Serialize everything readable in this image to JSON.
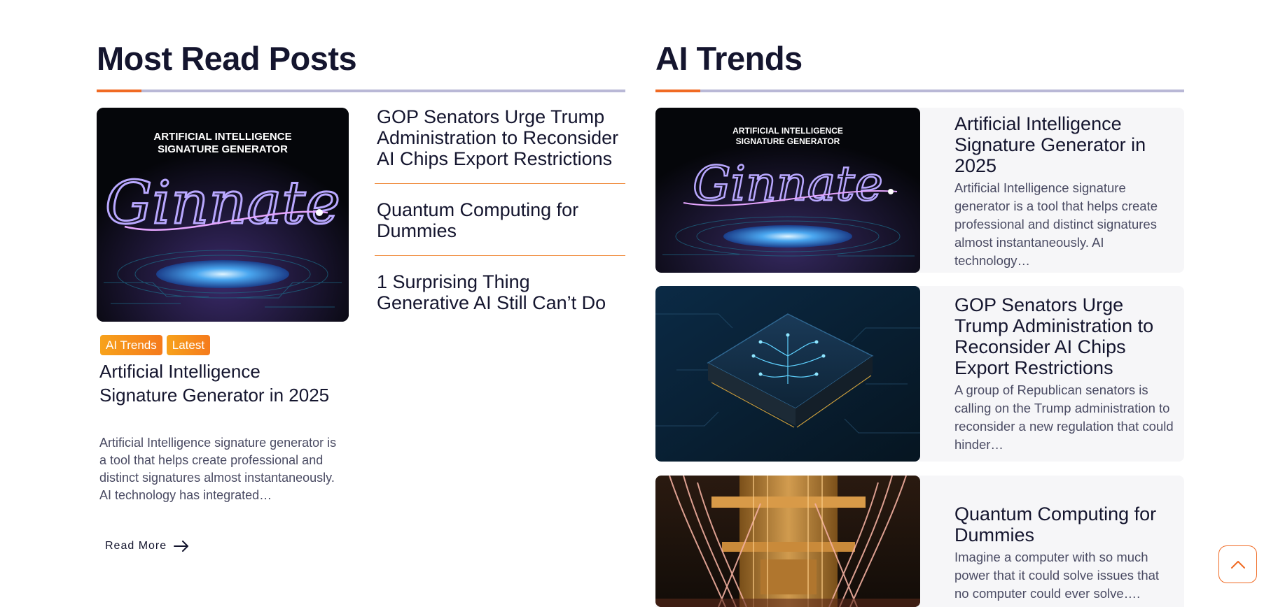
{
  "most_read": {
    "heading": "Most Read Posts",
    "featured": {
      "image_text_line1": "ARTIFICIAL INTELLIGENCE",
      "image_text_line2": "SIGNATURE GENERATOR",
      "image_script": "Ginnate",
      "tags": [
        "AI Trends",
        "Latest"
      ],
      "title": "Artificial Intelligence Signature Generator in 2025",
      "excerpt": "Artificial Intelligence signature generator is a tool that helps create professional and distinct signatures almost instantaneously. AI technology has integrated…",
      "read_more": "Read More"
    },
    "list": [
      "GOP Senators Urge Trump Administration to Reconsider AI Chips Export Restrictions",
      "Quantum Computing for Dummies",
      "1 Surprising Thing Generative AI Still Can’t Do"
    ]
  },
  "ai_trends": {
    "heading": "AI Trends",
    "cards": [
      {
        "title": "Artificial Intelligence Signature Generator in 2025",
        "excerpt": "Artificial Intelligence signature generator is a tool that helps create professional and distinct signatures almost instantaneously. AI technology…",
        "image_text_line1": "ARTIFICIAL INTELLIGENCE",
        "image_text_line2": "SIGNATURE GENERATOR",
        "image_script": "Ginnate"
      },
      {
        "title": "GOP Senators Urge Trump Administration to Reconsider AI Chips Export Restrictions",
        "excerpt": "A group  of Republican senators is calling on the Trump administration to reconsider a new regulation that could hinder…"
      },
      {
        "title": "Quantum Computing for Dummies",
        "excerpt": "Imagine a computer with so much power that it could solve issues that no computer could ever solve…."
      }
    ]
  },
  "colors": {
    "accent": "#f06a23",
    "heading": "#14152e",
    "rule": "#b9b8d6",
    "tag_gradient_start": "#f7a21b",
    "tag_gradient_end": "#f57a1c"
  },
  "icons": {
    "read_more": "arrow-right-icon",
    "scroll_top": "chevron-up-icon"
  }
}
